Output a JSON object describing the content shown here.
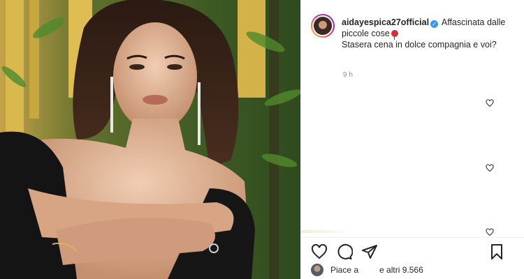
{
  "post": {
    "photo": {
      "description_icon": "photo"
    },
    "author": {
      "username": "aidayespica27official",
      "verified_icon": "verified-badge-icon"
    },
    "caption": {
      "line1": "Affascinata dalle piccole cose",
      "emoji_icon": "balloon-icon",
      "line2": "Stasera cena in dolce compagnia e voi?"
    },
    "time_ago": "9 h",
    "likes": {
      "prefix": "Piace a",
      "suffix": "e altri 9.566"
    },
    "colors": {
      "verified": "#3897f0",
      "text": "#262626",
      "muted": "#8e8e8e",
      "border": "#efefef"
    }
  }
}
